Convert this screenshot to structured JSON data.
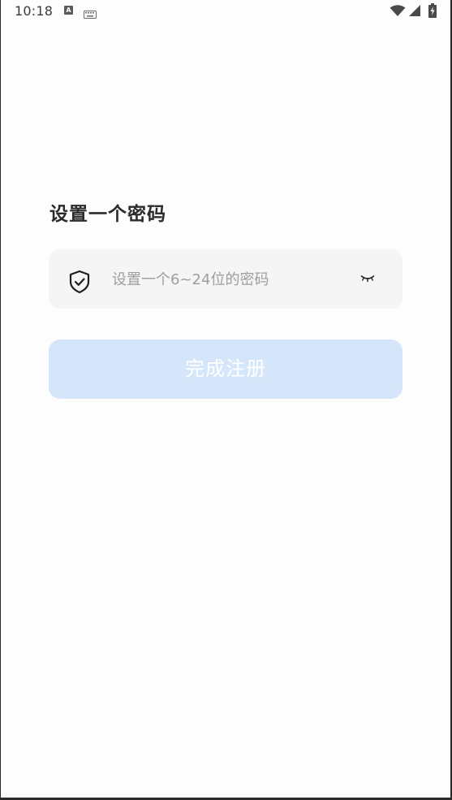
{
  "status_bar": {
    "time": "10:18",
    "a_icon_letter": "A",
    "icons": [
      "a-notification-icon",
      "keyboard-icon",
      "wifi-icon",
      "signal-icon",
      "battery-charging-icon"
    ]
  },
  "page": {
    "title": "设置一个密码"
  },
  "password_field": {
    "placeholder": "设置一个6~24位的密码",
    "value": "",
    "leading_icon": "shield-check-icon",
    "toggle_icon": "eye-closed-icon"
  },
  "submit": {
    "label": "完成注册",
    "background": "#d5e6fb",
    "text_color": "#ffffff",
    "enabled": false
  },
  "colors": {
    "background": "#fdfdfd",
    "input_background": "#f5f5f5",
    "placeholder": "#9e9e9e",
    "title": "#2b2b2b"
  }
}
